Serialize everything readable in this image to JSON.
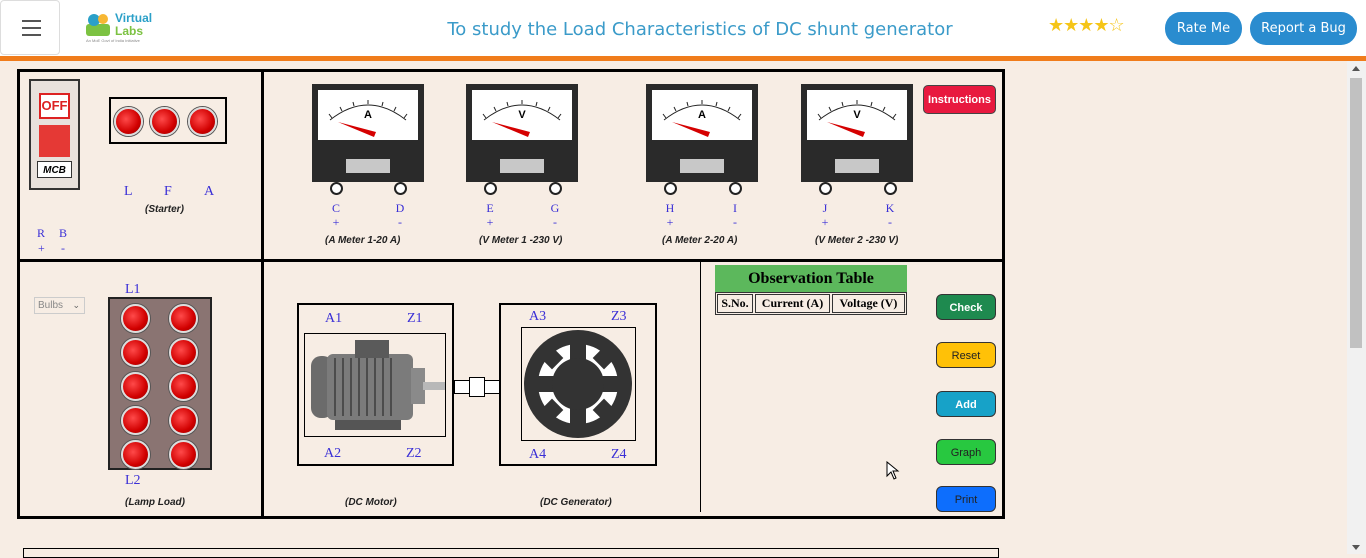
{
  "header": {
    "logo_line1": "Virtual",
    "logo_line2": "Labs",
    "logo_tagline": "An MoE Govt of India Initiative",
    "title": "To study the Load Characteristics of DC shunt generator",
    "rating": "★★★★☆",
    "rate_label": "Rate Me",
    "bug_label": "Report a Bug"
  },
  "mcb": {
    "state": "OFF",
    "label": "MCB"
  },
  "starter": {
    "terminals": [
      "L",
      "F",
      "A"
    ],
    "caption": "(Starter)"
  },
  "supply": {
    "terminals": [
      "R",
      "B"
    ],
    "polarity": [
      "+",
      "-"
    ]
  },
  "meters": [
    {
      "unit": "A",
      "terminals": [
        "C",
        "D"
      ],
      "polarity": [
        "+",
        "-"
      ],
      "caption": "(A Meter 1-20 A)"
    },
    {
      "unit": "V",
      "terminals": [
        "E",
        "G"
      ],
      "polarity": [
        "+",
        "-"
      ],
      "caption": "(V Meter 1 -230 V)"
    },
    {
      "unit": "A",
      "terminals": [
        "H",
        "I"
      ],
      "polarity": [
        "+",
        "-"
      ],
      "caption": "(A Meter 2-20 A)"
    },
    {
      "unit": "V",
      "terminals": [
        "J",
        "K"
      ],
      "polarity": [
        "+",
        "-"
      ],
      "caption": "(V Meter 2 -230 V)"
    }
  ],
  "instructions_label": "Instructions",
  "bulbs_select": {
    "selected": "Bulbs"
  },
  "lamp_load": {
    "top_label": "L1",
    "bottom_label": "L2",
    "caption": "(Lamp Load)"
  },
  "motor": {
    "labels": [
      "A1",
      "Z1",
      "A2",
      "Z2"
    ],
    "caption": "(DC Motor)"
  },
  "generator": {
    "labels": [
      "A3",
      "Z3",
      "A4",
      "Z4"
    ],
    "caption": "(DC Generator)"
  },
  "observation_table": {
    "title": "Observation Table",
    "columns": [
      "S.No.",
      "Current (A)",
      "Voltage (V)"
    ]
  },
  "buttons": {
    "check": "Check",
    "reset": "Reset",
    "add": "Add",
    "graph": "Graph",
    "print": "Print"
  },
  "colors": {
    "accent": "#f07c1b",
    "header_button": "#2a8ccf",
    "check": "#1e8a4f",
    "reset": "#ffc107",
    "add": "#17a2c8",
    "graph": "#28c840",
    "print": "#0d6efd",
    "instructions": "#e8193f"
  }
}
